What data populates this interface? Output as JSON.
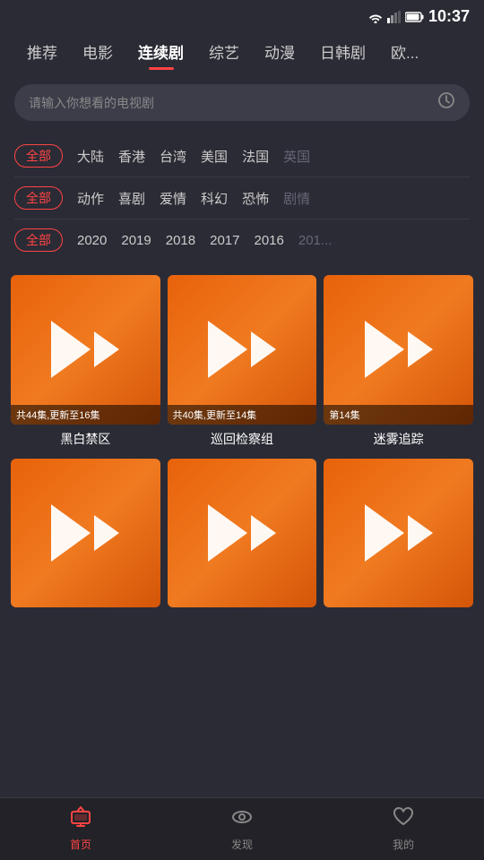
{
  "statusBar": {
    "time": "10:37"
  },
  "navTabs": [
    {
      "id": "recommend",
      "label": "推荐",
      "active": false
    },
    {
      "id": "movie",
      "label": "电影",
      "active": false
    },
    {
      "id": "series",
      "label": "连续剧",
      "active": true
    },
    {
      "id": "variety",
      "label": "综艺",
      "active": false
    },
    {
      "id": "anime",
      "label": "动漫",
      "active": false
    },
    {
      "id": "korean",
      "label": "日韩剧",
      "active": false
    },
    {
      "id": "western",
      "label": "欧...",
      "active": false
    }
  ],
  "searchBar": {
    "placeholder": "请输入你想看的电视剧"
  },
  "filters": [
    {
      "id": "region",
      "tags": [
        {
          "label": "全部",
          "active": true
        },
        {
          "label": "大陆",
          "active": false
        },
        {
          "label": "香港",
          "active": false
        },
        {
          "label": "台湾",
          "active": false
        },
        {
          "label": "美国",
          "active": false
        },
        {
          "label": "法国",
          "active": false
        },
        {
          "label": "英国",
          "active": false,
          "dim": true
        }
      ]
    },
    {
      "id": "genre",
      "tags": [
        {
          "label": "全部",
          "active": true
        },
        {
          "label": "动作",
          "active": false
        },
        {
          "label": "喜剧",
          "active": false
        },
        {
          "label": "爱情",
          "active": false
        },
        {
          "label": "科幻",
          "active": false
        },
        {
          "label": "恐怖",
          "active": false
        },
        {
          "label": "剧情",
          "active": false,
          "dim": true
        }
      ]
    },
    {
      "id": "year",
      "tags": [
        {
          "label": "全部",
          "active": true
        },
        {
          "label": "2020",
          "active": false
        },
        {
          "label": "2019",
          "active": false
        },
        {
          "label": "2018",
          "active": false
        },
        {
          "label": "2017",
          "active": false
        },
        {
          "label": "2016",
          "active": false
        },
        {
          "label": "201...",
          "active": false,
          "dim": true
        }
      ]
    }
  ],
  "contentItems": [
    {
      "id": 1,
      "title": "黑白禁区",
      "badge": "共44集,更新至16集",
      "hasBadge": true
    },
    {
      "id": 2,
      "title": "巡回检察组",
      "badge": "共40集,更新至14集",
      "hasBadge": true
    },
    {
      "id": 3,
      "title": "迷雾追踪",
      "badge": "第14集",
      "hasBadge": true
    },
    {
      "id": 4,
      "title": "",
      "badge": "",
      "hasBadge": false
    },
    {
      "id": 5,
      "title": "",
      "badge": "",
      "hasBadge": false
    },
    {
      "id": 6,
      "title": "",
      "badge": "",
      "hasBadge": false
    }
  ],
  "bottomNav": [
    {
      "id": "home",
      "label": "首页",
      "active": true,
      "icon": "tv"
    },
    {
      "id": "discover",
      "label": "发现",
      "active": false,
      "icon": "eye"
    },
    {
      "id": "mine",
      "label": "我的",
      "active": false,
      "icon": "heart"
    }
  ]
}
